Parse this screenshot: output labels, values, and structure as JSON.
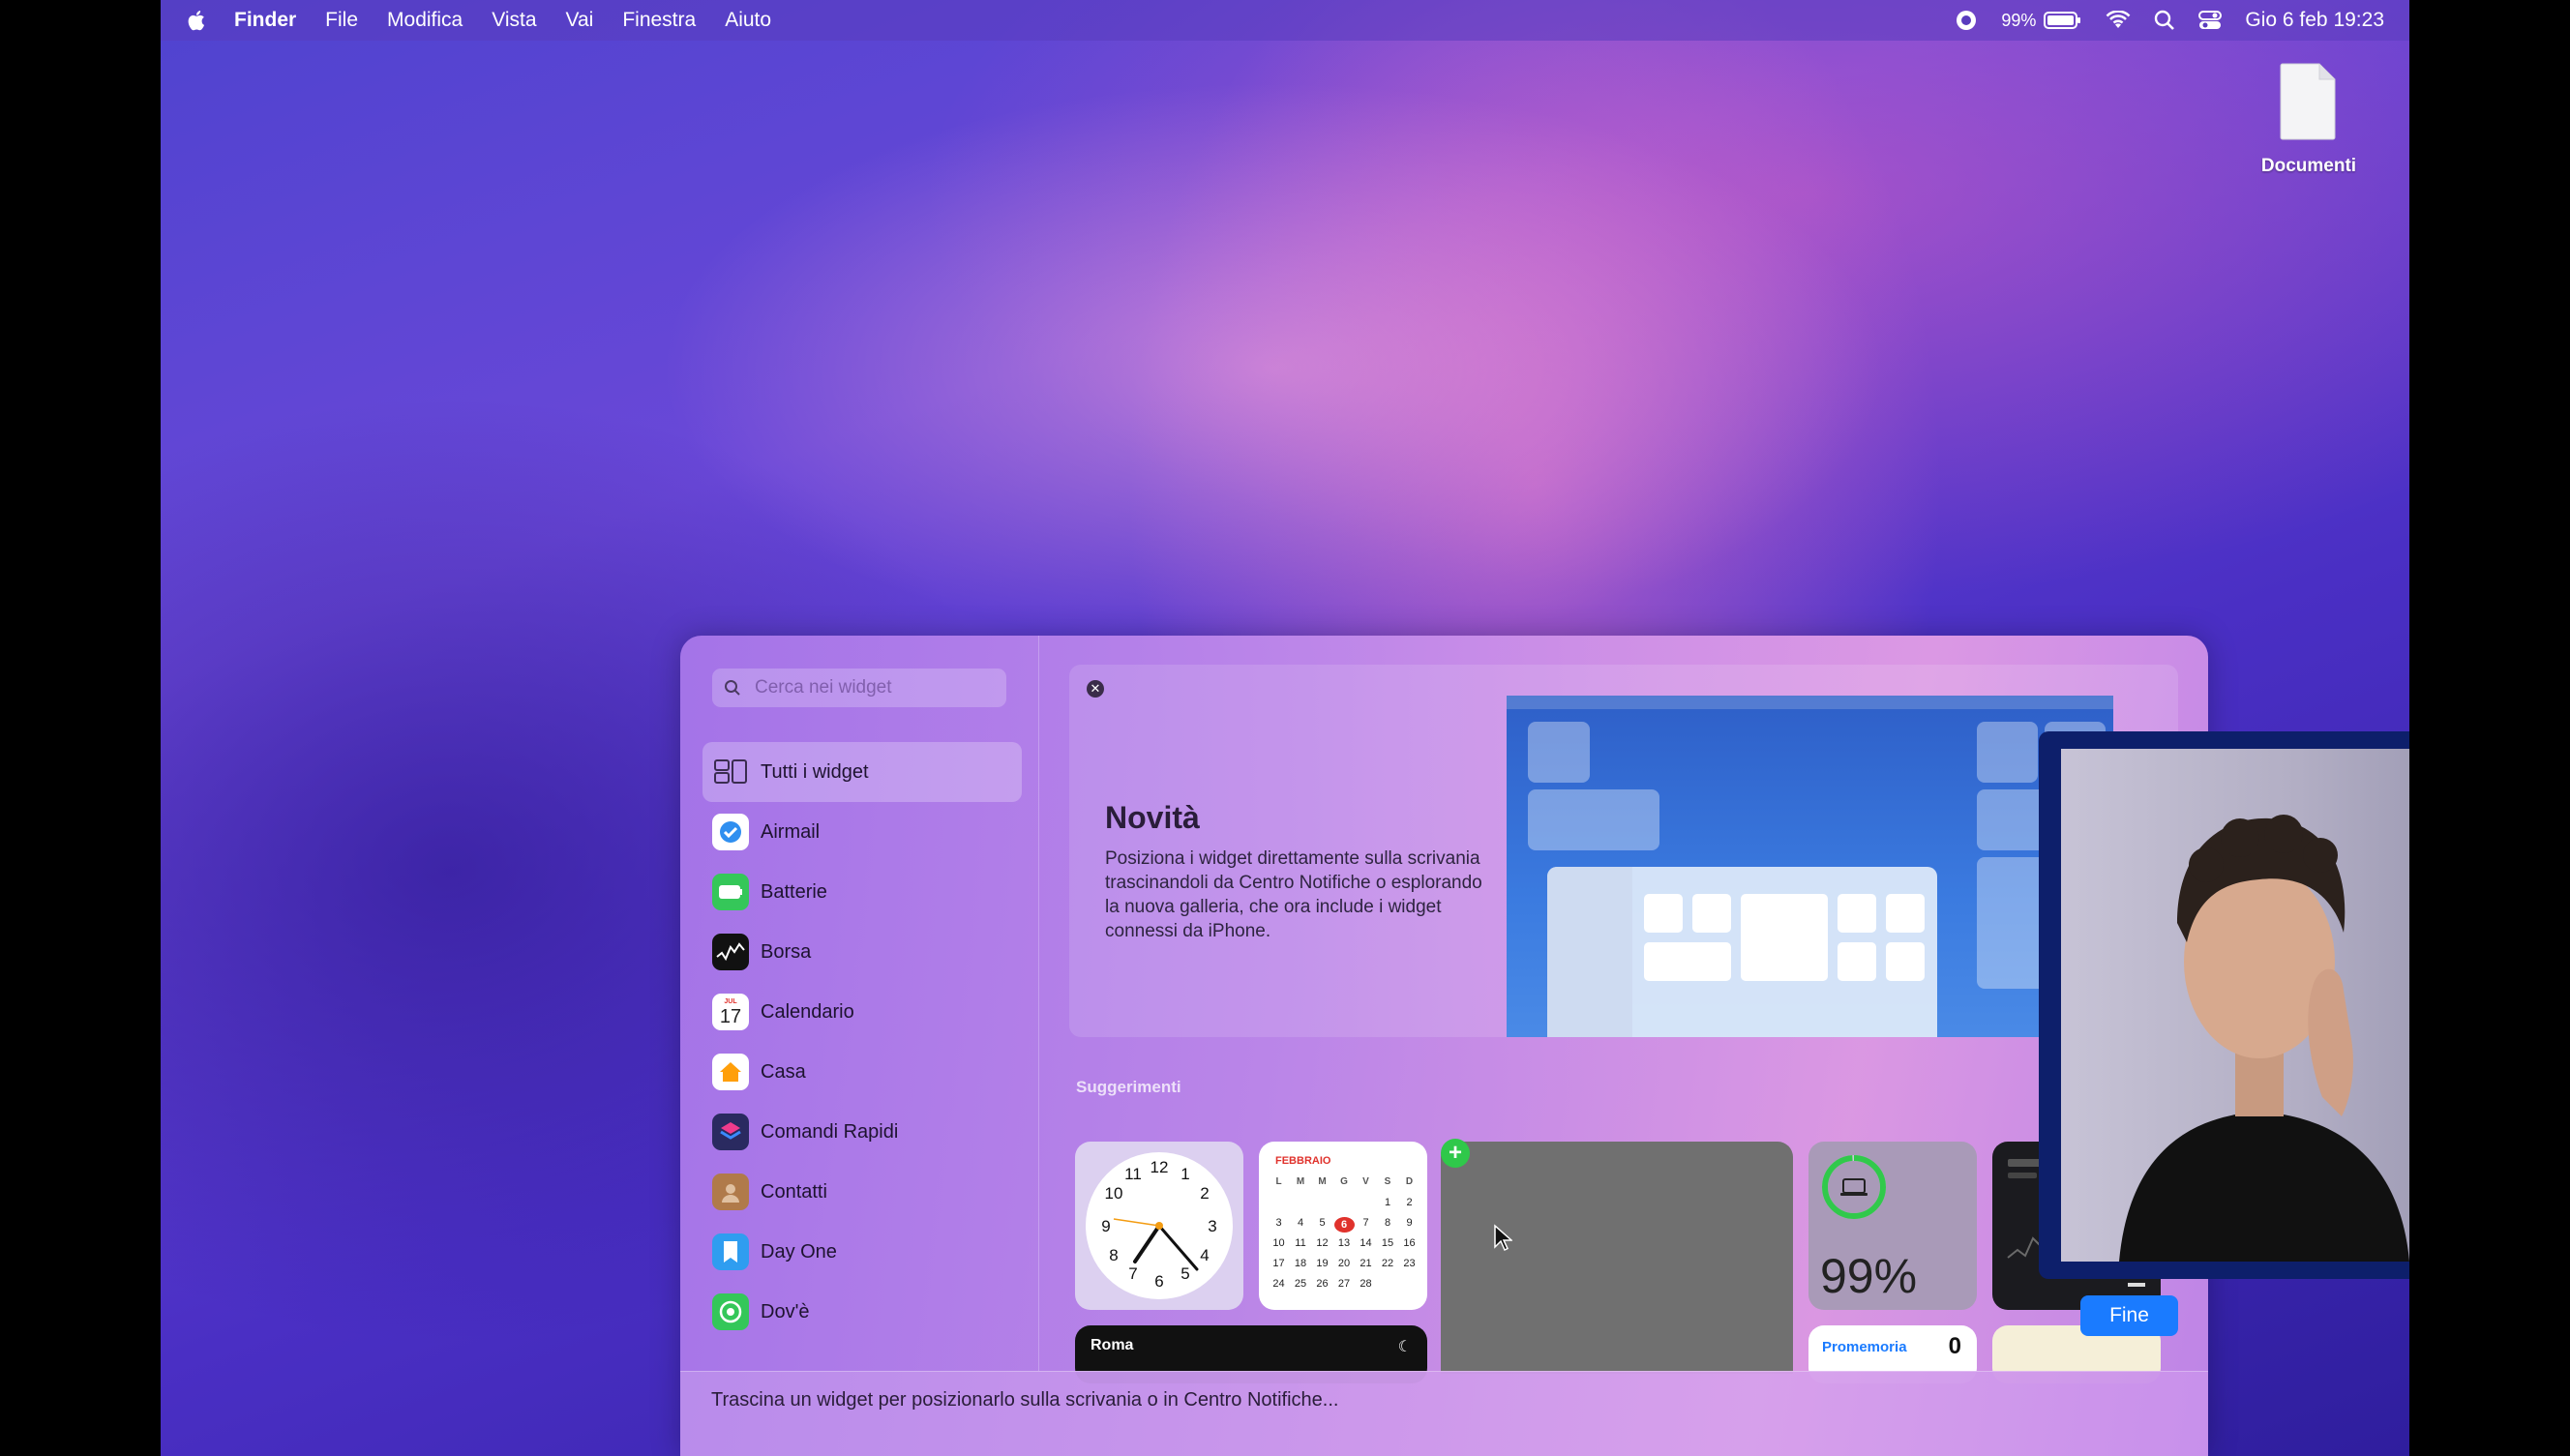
{
  "menubar": {
    "app_name": "Finder",
    "menus": [
      "File",
      "Modifica",
      "Vista",
      "Vai",
      "Finestra",
      "Aiuto"
    ],
    "battery_percent": "99%",
    "datetime": "Gio 6 feb  19:23"
  },
  "desktop": {
    "icons": [
      {
        "label": "Documenti",
        "icon": "document-icon"
      }
    ]
  },
  "widget_gallery": {
    "search_placeholder": "Cerca nei widget",
    "sidebar_items": [
      {
        "label": "Tutti i widget",
        "icon": "grid-icon",
        "color": "#7a6a9a"
      },
      {
        "label": "Airmail",
        "icon": "airmail-icon",
        "color": "#2f8ff0"
      },
      {
        "label": "Batterie",
        "icon": "battery-icon",
        "color": "#35c759"
      },
      {
        "label": "Borsa",
        "icon": "stocks-icon",
        "color": "#111111"
      },
      {
        "label": "Calendario",
        "icon": "calendar-icon",
        "color": "#ffffff",
        "badge": "17",
        "badge_top": "JUL"
      },
      {
        "label": "Casa",
        "icon": "home-icon",
        "color": "#ff9f0a"
      },
      {
        "label": "Comandi Rapidi",
        "icon": "shortcuts-icon",
        "color": "#c2338f"
      },
      {
        "label": "Contatti",
        "icon": "contacts-icon",
        "color": "#b07a4a"
      },
      {
        "label": "Day One",
        "icon": "dayone-icon",
        "color": "#2f9df0"
      },
      {
        "label": "Dov'è",
        "icon": "findmy-icon",
        "color": "#34c759"
      }
    ],
    "hero": {
      "title": "Novità",
      "body": "Posiziona i widget direttamente sulla scrivania trascinandoli da Centro Notifiche o esplorando la nuova galleria, che ora include i widget connessi da iPhone."
    },
    "suggestions_title": "Suggerimenti",
    "calendar_widget": {
      "month": "FEBBRAIO",
      "weekdays": [
        "L",
        "M",
        "M",
        "G",
        "V",
        "S",
        "D"
      ],
      "weeks": [
        [
          "",
          "",
          "",
          "",
          "",
          "1",
          "2"
        ],
        [
          "3",
          "4",
          "5",
          "6",
          "7",
          "8",
          "9"
        ],
        [
          "10",
          "11",
          "12",
          "13",
          "14",
          "15",
          "16"
        ],
        [
          "17",
          "18",
          "19",
          "20",
          "21",
          "22",
          "23"
        ],
        [
          "24",
          "25",
          "26",
          "27",
          "28",
          "",
          ""
        ]
      ],
      "today": "6"
    },
    "battery_widget": {
      "percent": "99%",
      "level": 0.99
    },
    "weather_widget": {
      "city": "Roma"
    },
    "reminders_widget": {
      "title": "Promemoria",
      "count": "0"
    },
    "footer_text": "Trascina un widget per posizionarlo sulla scrivania o in Centro Notifiche...",
    "done_label": "Fine"
  }
}
